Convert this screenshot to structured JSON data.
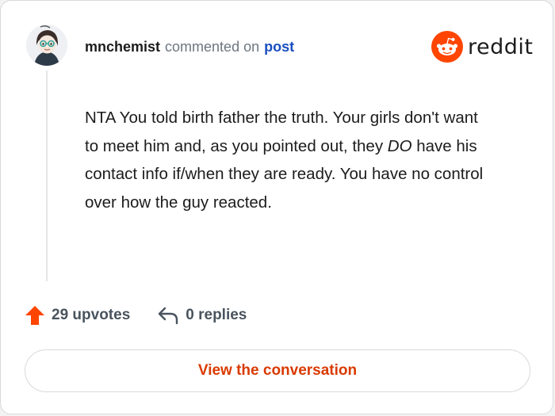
{
  "comment": {
    "author": "mnchemist",
    "action_text": "commented on",
    "target_link": "post",
    "body_before_emphasis": "NTA You told birth father the truth. Your girls don't want to meet him and, as you pointed out, they ",
    "body_emphasis": "DO",
    "body_after_emphasis": " have his contact info if/when they are ready. You have no control over how the guy reacted."
  },
  "brand": {
    "wordmark": "reddit",
    "color": "#ff4500",
    "icon": "reddit-snoo-icon"
  },
  "stats": {
    "upvotes_label": "29 upvotes",
    "replies_label": "0 replies",
    "upvote_icon": "upvote-arrow-icon",
    "reply_icon": "reply-arrow-icon",
    "upvote_color": "#ff4500"
  },
  "cta": {
    "label": "View the conversation",
    "color": "#d93a00"
  }
}
